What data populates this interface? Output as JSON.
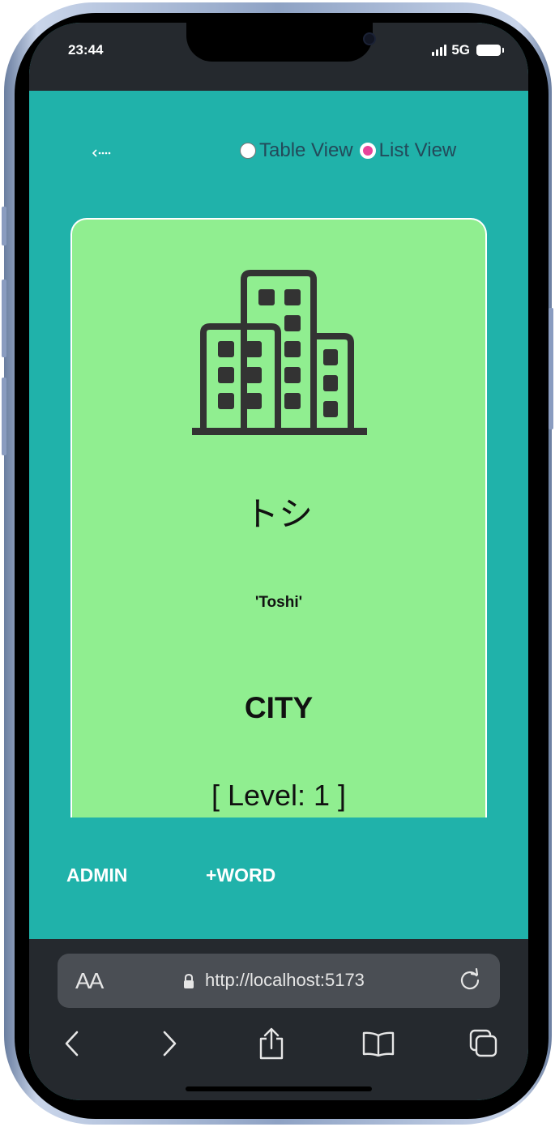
{
  "status": {
    "time": "23:44",
    "network": "5G"
  },
  "app": {
    "back_icon": "dotted-left-arrow-icon",
    "view_options": [
      {
        "label": "Table View",
        "selected": false
      },
      {
        "label": "List View",
        "selected": true
      }
    ],
    "card": {
      "icon": "city-buildings-icon",
      "word": "トシ",
      "romaji": "'Toshi'",
      "category": "CITY",
      "level": "[ Level: 1 ]"
    },
    "nav": {
      "admin_label": "ADMIN",
      "add_word_label": "+WORD"
    },
    "colors": {
      "background": "#20b2aa",
      "card": "#90ee90",
      "radio_selected": "#e6449a"
    }
  },
  "browser": {
    "text_size_label": "AA",
    "url": "http://localhost:5173",
    "toolbar_icons": [
      "back-icon",
      "forward-icon",
      "share-icon",
      "bookmarks-icon",
      "tabs-icon"
    ]
  }
}
